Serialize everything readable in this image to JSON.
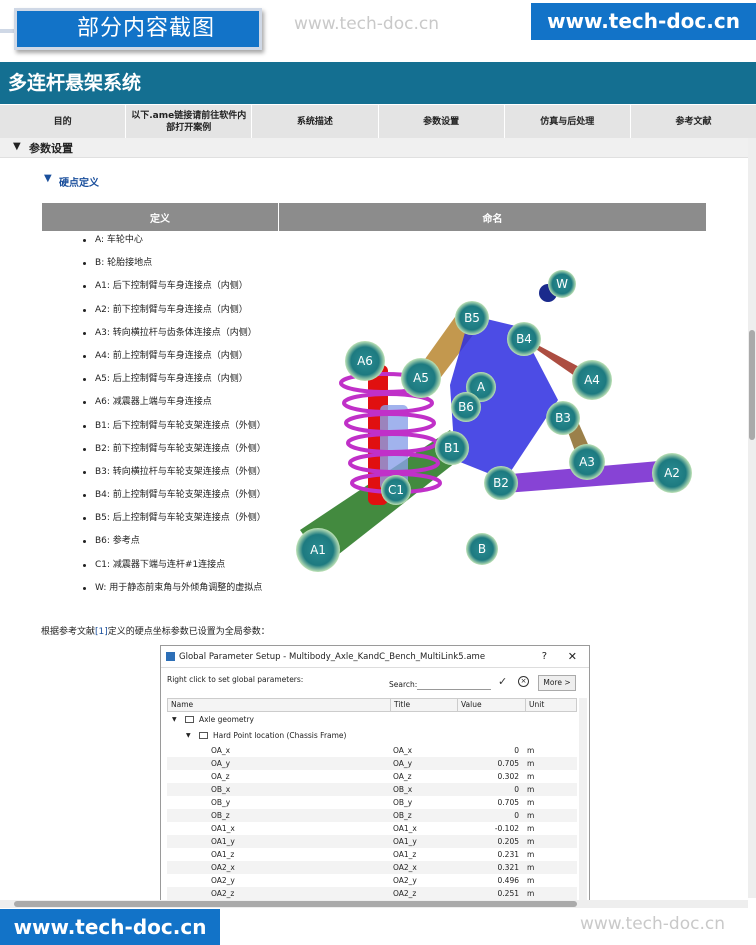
{
  "banner": {
    "badge": "部分内容截图",
    "watermark": "www.tech-doc.cn",
    "brand": "www.tech-doc.cn"
  },
  "page_title": "多连杆悬架系统",
  "tabs": [
    "目的",
    "以下.ame链接请前往软件内部打开案例",
    "系统描述",
    "参数设置",
    "仿真与后处理",
    "参考文献"
  ],
  "section": "参数设置",
  "subsection": "硬点定义",
  "table_headers": [
    "定义",
    "命名"
  ],
  "points": [
    {
      "k": "A",
      "v": ": 车轮中心"
    },
    {
      "k": "B",
      "v": ": 轮胎接地点"
    },
    {
      "k": "A1",
      "v": ": 后下控制臂与车身连接点（内侧）"
    },
    {
      "k": "A2",
      "v": ": 前下控制臂与车身连接点（内侧）"
    },
    {
      "k": "A3",
      "v": ": 转向横拉杆与齿条体连接点（内侧）"
    },
    {
      "k": "A4",
      "v": ": 前上控制臂与车身连接点（内侧）"
    },
    {
      "k": "A5",
      "v": ": 后上控制臂与车身连接点（内侧）"
    },
    {
      "k": "A6",
      "v": ": 减震器上端与车身连接点"
    },
    {
      "k": "B1",
      "v": ": 后下控制臂与车轮支架连接点（外侧）"
    },
    {
      "k": "B2",
      "v": ": 前下控制臂与车轮支架连接点（外侧）"
    },
    {
      "k": "B3",
      "v": ": 转向横拉杆与车轮支架连接点（外侧）"
    },
    {
      "k": "B4",
      "v": ": 前上控制臂与车轮支架连接点（外侧）"
    },
    {
      "k": "B5",
      "v": ": 后上控制臂与车轮支架连接点（外侧）"
    },
    {
      "k": "B6",
      "v": ": 参考点"
    },
    {
      "k": "C1",
      "v": ": 减震器下端与连杆#1连接点"
    },
    {
      "k": "W",
      "v": ": 用于静态前束角与外倾角调整的虚拟点"
    }
  ],
  "diagram_labels": {
    "W": "W",
    "B5": "B5",
    "B4": "B4",
    "A6": "A6",
    "A5": "A5",
    "A4": "A4",
    "A": "A",
    "B6": "B6",
    "B3": "B3",
    "B1": "B1",
    "A3": "A3",
    "A2": "A2",
    "B2": "B2",
    "C1": "C1",
    "A1": "A1",
    "B": "B"
  },
  "ref_line": {
    "pre": "根据参考文献",
    "link": "[1]",
    "post": "定义的硬点坐标参数已设置为全局参数："
  },
  "dialog": {
    "title": "Global Parameter Setup - Multibody_Axle_KandC_Bench_MultiLink5.ame",
    "help": "?",
    "close": "✕",
    "hint": "Right click to set global parameters:",
    "search_label": "Search:",
    "more": "More >",
    "columns": [
      "Name",
      "Title",
      "Value",
      "Unit"
    ],
    "group": "Axle geometry",
    "subgroup": "Hard Point location (Chassis Frame)",
    "rows": [
      {
        "n": "OA_x",
        "t": "OA_x",
        "v": "0",
        "u": "m"
      },
      {
        "n": "OA_y",
        "t": "OA_y",
        "v": "0.705",
        "u": "m"
      },
      {
        "n": "OA_z",
        "t": "OA_z",
        "v": "0.302",
        "u": "m"
      },
      {
        "n": "OB_x",
        "t": "OB_x",
        "v": "0",
        "u": "m"
      },
      {
        "n": "OB_y",
        "t": "OB_y",
        "v": "0.705",
        "u": "m"
      },
      {
        "n": "OB_z",
        "t": "OB_z",
        "v": "0",
        "u": "m"
      },
      {
        "n": "OA1_x",
        "t": "OA1_x",
        "v": "-0.102",
        "u": "m"
      },
      {
        "n": "OA1_y",
        "t": "OA1_y",
        "v": "0.205",
        "u": "m"
      },
      {
        "n": "OA1_z",
        "t": "OA1_z",
        "v": "0.231",
        "u": "m"
      },
      {
        "n": "OA2_x",
        "t": "OA2_x",
        "v": "0.321",
        "u": "m"
      },
      {
        "n": "OA2_y",
        "t": "OA2_y",
        "v": "0.496",
        "u": "m"
      },
      {
        "n": "OA2_z",
        "t": "OA2_z",
        "v": "0.251",
        "u": "m"
      }
    ]
  },
  "footer": {
    "brand": "www.tech-doc.cn",
    "watermark": "www.tech-doc.cn"
  }
}
